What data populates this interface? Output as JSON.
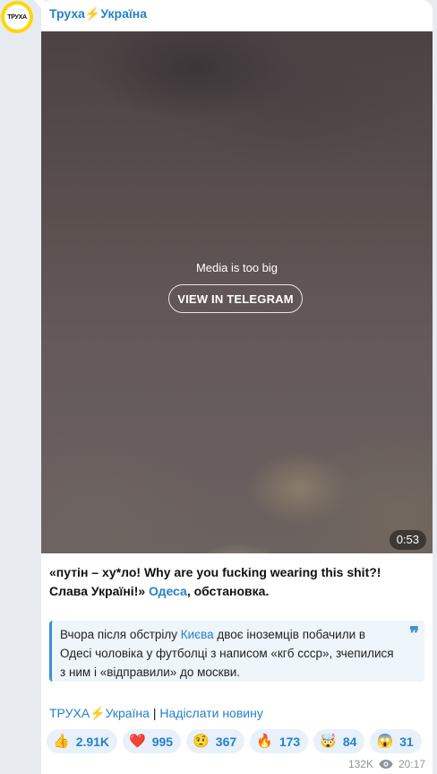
{
  "channel": {
    "avatar_text": "ТРУХА",
    "name": "Труха⚡Україна"
  },
  "media": {
    "message": "Media is too big",
    "button_label": "VIEW IN TELEGRAM",
    "duration": "0:53"
  },
  "caption": {
    "part1": "«путін – ху*ло! Why are you fucking wearing this shit?! Слава Україні!» ",
    "link": "Одеса",
    "part2": ", обстановка."
  },
  "quote": {
    "part1": "Вчора після обстрілу ",
    "link": "Києва",
    "part2": " двоє іноземців побачили в Одесі чоловіка у футболці з написом «кгб ссср», зчепилися з ним і «відправили» до москви.",
    "mark": "❞"
  },
  "footer": {
    "link1": "ТРУХА⚡Україна",
    "separator": " | ",
    "link2": "Надіслати новину"
  },
  "reactions": [
    {
      "icon": "thumbs-up-icon",
      "emoji": "👍",
      "count": "2.91K"
    },
    {
      "icon": "heart-icon",
      "emoji": "❤️",
      "count": "995"
    },
    {
      "icon": "raised-eyebrow-face-icon",
      "emoji": "🤨",
      "count": "367"
    },
    {
      "icon": "fire-icon",
      "emoji": "🔥",
      "count": "173"
    },
    {
      "icon": "exploding-head-icon",
      "emoji": "🤯",
      "count": "84"
    },
    {
      "icon": "screaming-face-icon",
      "emoji": "😱",
      "count": "31"
    }
  ],
  "meta": {
    "views": "132K",
    "time": "20:17"
  }
}
